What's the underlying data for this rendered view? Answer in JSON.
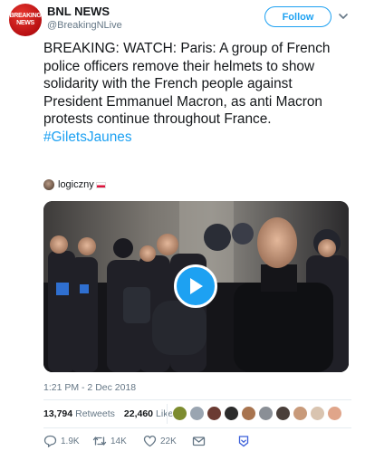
{
  "account": {
    "name": "BNL NEWS",
    "handle": "@BreakingNLive",
    "avatar_text_line1": "BREAKING",
    "avatar_text_line2": "NEWS",
    "avatar_color": "#c8161d"
  },
  "header": {
    "follow_label": "Follow"
  },
  "tweet": {
    "text": "BREAKING: WATCH: Paris: A group of French police officers remove their helmets to show solidarity with the French people against President Emmanuel Macron, as anti Macron protests continue throughout France.",
    "hashtag": "#GiletsJaunes",
    "tagged_user": "logiczny",
    "timestamp": "1:21 PM - 2 Dec 2018"
  },
  "stats": {
    "retweets_count": "13,794",
    "retweets_label": "Retweets",
    "likes_count": "22,460",
    "likes_label": "Likes"
  },
  "actions": {
    "reply_count": "1.9K",
    "retweet_count": "14K",
    "like_count": "22K"
  },
  "colors": {
    "accent": "#1da1f2",
    "text_primary": "#14171a",
    "text_secondary": "#657786"
  },
  "icons": [
    "chevron-down-icon",
    "play-icon",
    "reply-icon",
    "retweet-icon",
    "heart-icon",
    "mail-icon",
    "bookmark-icon"
  ]
}
